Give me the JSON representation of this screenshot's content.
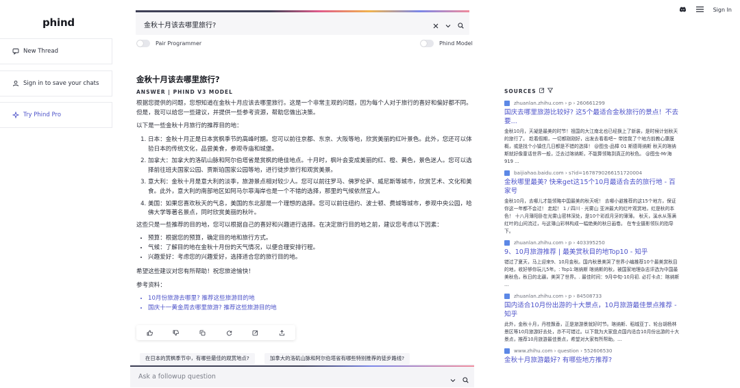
{
  "app": {
    "logo": "phind"
  },
  "sidebar": {
    "items": [
      {
        "label": "New Thread"
      },
      {
        "label": "Sign in to save your chats"
      },
      {
        "label": "Try Phind Pro"
      }
    ]
  },
  "topbar": {
    "signin": "Sign In"
  },
  "search": {
    "value": "金秋十月该去哪里旅行?"
  },
  "toggles": {
    "pair": "Pair Programmer",
    "model": "Phind Model"
  },
  "answer": {
    "question": "金秋十月该去哪里旅行?",
    "label": "ANSWER | PHIND V3 MODEL",
    "intro": "根据您提供的问题，您想知道在金秋十月应该去哪里旅行。这是一个非常主观的问题，因为每个人对于旅行的喜好和偏好都不同。但是，我可以给您一些建议，并提供一些参考资源，帮助您做出决策。",
    "list_intro": "以下是一些金秋十月旅行的推荐目的地：",
    "destinations": [
      "日本：金秋十月正是日本赏枫季节的高峰时期。您可以前往京都、东京、大阪等地，欣赏美丽的红叶景色。此外，您还可以体验日本的传统文化，品尝美食，参观寺庙和城堡。",
      "加拿大：加拿大的洛矶山脉和阿尔伯塔省是赏枫的绝佳地点。十月时，枫叶会变成美丽的红、橙、黄色，景色迷人。您可以选择前往班夫国家公园、贾斯珀国家公园等地，进行徒步旅行和观赏美景。",
      "意大利：金秋十月是意大利的淡季，旅游景点相对较少人。您可以前往罗马、佛罗伦萨、威尼斯等城市，欣赏艺术、文化和美食。此外，意大利的南部地区如阿马尔菲海岸也是一个不错的选择，那里的气候依然宜人。",
      "美国：如果您喜欢秋天的气息，美国的东北部是一个理想的选择。您可以前往纽约、波士顿、费城等城市，参观中央公园，哈佛大学等著名景点，同时欣赏美丽的秋叶。"
    ],
    "factors_intro": "这些只是一些推荐的目的地，您可以根据自己的喜好和兴趣进行选择。在决定旅行目的地之前，建议您考虑以下因素：",
    "factors": [
      "预算：根据您的预算，确定目的地和旅行方式。",
      "气候：了解目的地在金秋十月份的天气情况，以便合理安排行程。",
      "兴趣爱好：考虑您的兴趣爱好，选择适合您的旅行目的地。"
    ],
    "closing": "希望这些建议对您有所帮助！祝您旅途愉快！",
    "refs_label": "参考资料：",
    "refs": [
      "10月份旅游去哪里? 推荐这些旅游目的地",
      "国庆十一黄金周去哪里旅游? 推荐这些旅游目的地"
    ]
  },
  "suggestions": [
    "在日本的赏枫季节中，有哪些最佳的观赏地点?",
    "加拿大的洛矶山脉和阿尔伯塔省有哪些特别推荐的徒步路线?"
  ],
  "followup": {
    "placeholder": "Ask a followup question"
  },
  "sources": {
    "label": "SOURCES",
    "items": [
      {
        "url": "zhuanlan.zhihu.com › p › 260661299",
        "title": "国庆去哪里旅游比较好? 这5个最适合金秋旅行的景点！不去要...",
        "snippet": "金秋10月，天凝是最美的时节！祖国的大江南北也已经换上了新装，是时候计划秋天的旅行了。 趁着假期，一切都刚刚好，出发去看看吧~ 带挂我了个地方前教心康膜概，或是找个小镇住几日都是不错的选择！ @图虫-品樟 01 斯德哥纳斯 秋天的喀纳斯就好像童话世界一般，泛去过喀纳斯，不能算领略到真正的秋色。 @图虫-Mr海919 ..."
      },
      {
        "url": "baijiahao.baidu.com › s?id=1678790266151720004",
        "title": "金秋哪里最美? 快来get这15个10月最适合去的旅行地 - 百家号",
        "snippet": "金秋10月，去哪儿才能领略中国最美的秋天呢！ 去哪小避推荐的这15个地方，保证你这一年都不会过！ 走起！ 1 / 四川 · 光雾山 亚洲最大的红叶观赏地，红是秋的本色！ 十八月薄阳卧在光雾山密林深处，是10个彩叔月牙的薄薄。 秋天，溪水从落满红叶的山间流过，与这薄山彩林构成一幅绝美的秋日画卷。 在专业摄影领队的指导下。"
      },
      {
        "url": "zhuanlan.zhihu.com › p › 403395250",
        "title": "9、10月旅游推荐 | 最美赏秋目的地Top10 - 知乎",
        "snippet": "错过了夏天，马上迎来9、10月金秋。国内秋景美哭了世界小编推荐10个最美赏秋目的地，收好够你玩儿5年。: Top1:喀纳斯 喀纳斯的秋，被国家地理杂志评选为中国最美秋色，秋日的北疆，美哭了世界。. 最佳时间：9月中旬-10月初. 必打卡点：喀纳斯 ..."
      },
      {
        "url": "zhuanlan.zhihu.com › p › 84508733",
        "title": "国内适合10月份出游的十大景点，10月旅游最佳景点推荐 - 知乎",
        "snippet": "此外，金秋十月，丹桂飘香，正是旅游景就好时节。喀纳斯、稻城亚丁、轮台胡杨林景区等10月旅游好去处，亦不可错过。以下我为大家盘点国内适合10月份出游的十大景点，推荐10月旅游最佳景点，希望对大家有所帮助。..."
      },
      {
        "url": "www.zhihu.com › question › 552606530",
        "title": "金秋十月旅游最好? 有哪些地方推荐?",
        "snippet": ""
      }
    ]
  },
  "colors": {
    "accent": "#4c52c9",
    "link": "#4c52c9"
  }
}
